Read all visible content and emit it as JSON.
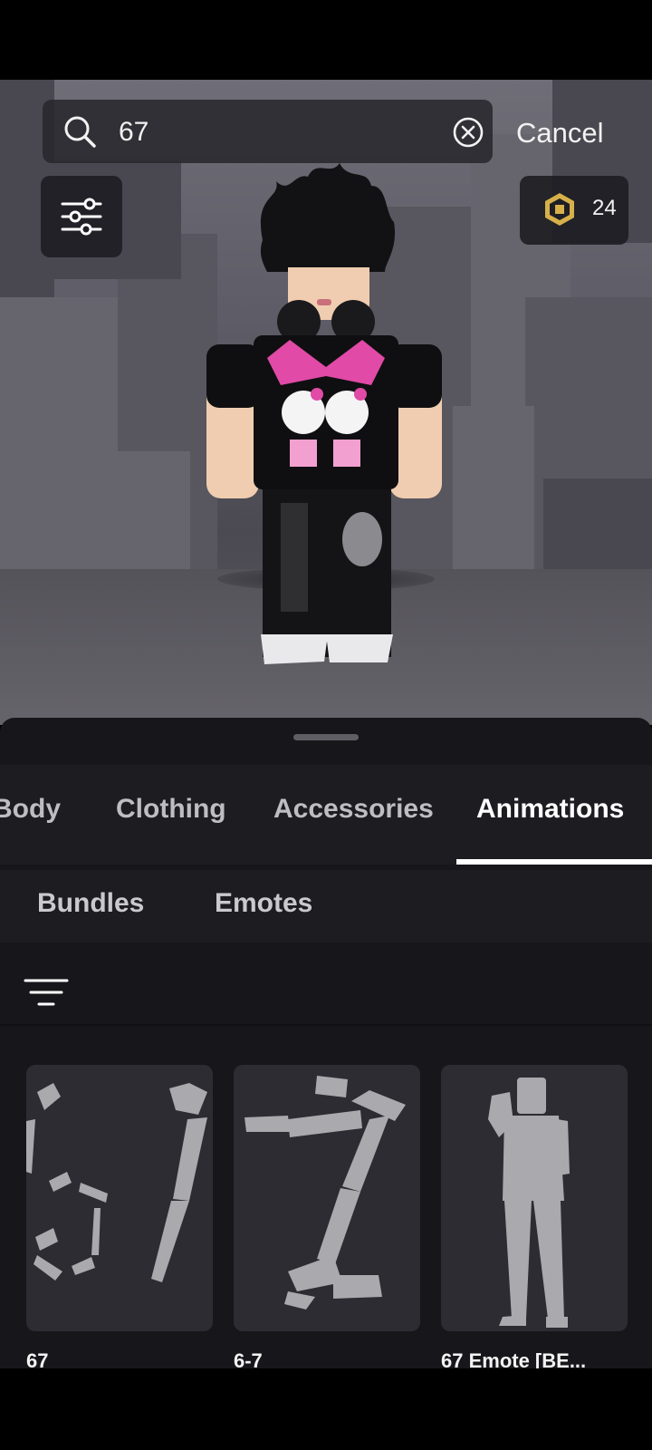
{
  "search": {
    "query": "67",
    "cancel_label": "Cancel"
  },
  "currency": {
    "icon": "robux-icon",
    "amount": "24",
    "accent": "#d7b04a"
  },
  "category_tabs": [
    {
      "label": "Body",
      "active": false
    },
    {
      "label": "Clothing",
      "active": false
    },
    {
      "label": "Accessories",
      "active": false
    },
    {
      "label": "Animations",
      "active": true
    }
  ],
  "sub_tabs": [
    {
      "label": "Bundles"
    },
    {
      "label": "Emotes"
    }
  ],
  "items": [
    {
      "name": "67"
    },
    {
      "name": "6-7"
    },
    {
      "name": "67 Emote [BE..."
    }
  ],
  "icons": {
    "search": "search-icon",
    "clear": "clear-circle-icon",
    "filter": "sliders-icon",
    "sort": "sort-lines-icon"
  }
}
